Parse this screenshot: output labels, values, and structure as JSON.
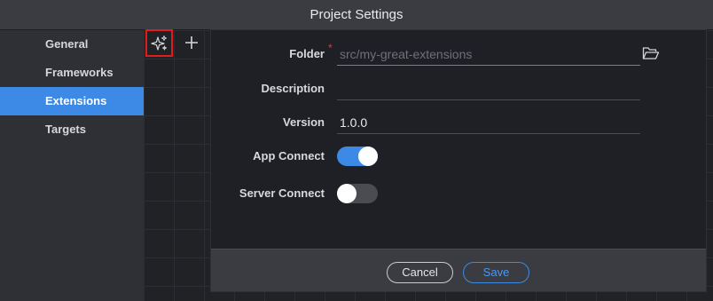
{
  "window": {
    "title": "Project Settings"
  },
  "sidebar": {
    "items": [
      {
        "label": "General",
        "active": false
      },
      {
        "label": "Frameworks",
        "active": false
      },
      {
        "label": "Extensions",
        "active": true
      },
      {
        "label": "Targets",
        "active": false
      }
    ]
  },
  "toolbar": {
    "magic_icon": "sparkles-icon",
    "add_icon": "plus-icon"
  },
  "form": {
    "folder": {
      "label": "Folder",
      "required_mark": "*",
      "value": "",
      "placeholder": "src/my-great-extensions",
      "icon": "folder-open-icon"
    },
    "description": {
      "label": "Description",
      "value": ""
    },
    "version": {
      "label": "Version",
      "value": "1.0.0"
    },
    "app_connect": {
      "label": "App Connect",
      "enabled": true
    },
    "server_connect": {
      "label": "Server Connect",
      "enabled": false
    }
  },
  "footer": {
    "cancel_label": "Cancel",
    "save_label": "Save"
  },
  "colors": {
    "accent": "#3d8ae6",
    "highlight_border": "#e21c1c",
    "required": "#e23b3b"
  }
}
